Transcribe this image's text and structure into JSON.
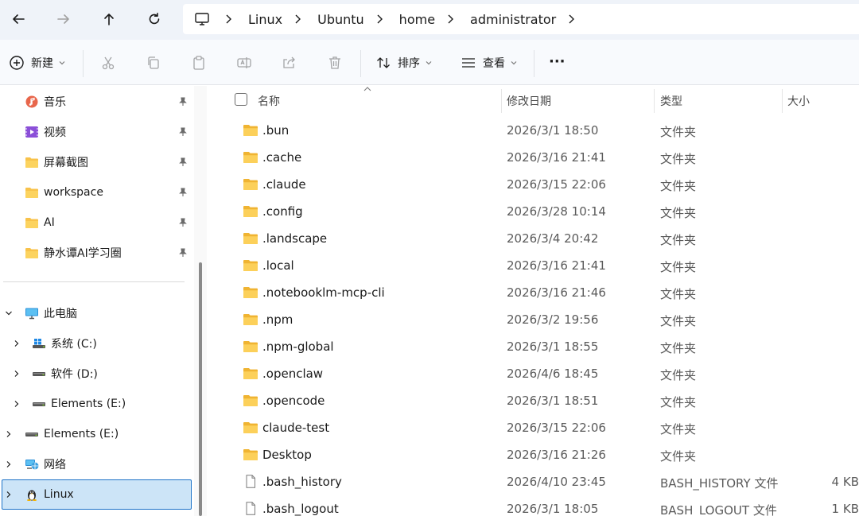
{
  "navigation": {
    "back": "back-arrow",
    "forward": "forward-arrow",
    "up": "up-arrow",
    "refresh": "refresh"
  },
  "address": {
    "root_icon": "this-pc-icon",
    "crumbs": [
      "Linux",
      "Ubuntu",
      "home",
      "administrator"
    ]
  },
  "toolbar": {
    "new_label": "新建",
    "sort_label": "排序",
    "view_label": "查看",
    "more_label": "···"
  },
  "sidebar": {
    "quick_access": [
      {
        "label": "音乐",
        "icon": "music-icon"
      },
      {
        "label": "视频",
        "icon": "video-icon"
      },
      {
        "label": "屏幕截图",
        "icon": "folder-icon"
      },
      {
        "label": "workspace",
        "icon": "folder-icon"
      },
      {
        "label": "AI",
        "icon": "folder-icon"
      },
      {
        "label": "静水谭AI学习圈",
        "icon": "folder-icon"
      }
    ],
    "this_pc": "此电脑",
    "drives": [
      {
        "label": "系统 (C:)",
        "icon": "windows-drive-icon"
      },
      {
        "label": "软件 (D:)",
        "icon": "drive-icon"
      },
      {
        "label": "Elements (E:)",
        "icon": "drive-icon"
      }
    ],
    "elements": "Elements (E:)",
    "network": "网络",
    "linux": "Linux"
  },
  "columns": {
    "name": "名称",
    "date": "修改日期",
    "type": "类型",
    "size": "大小"
  },
  "files": [
    {
      "name": ".bun",
      "date": "2026/3/1 18:50",
      "type": "文件夹",
      "size": "",
      "kind": "folder"
    },
    {
      "name": ".cache",
      "date": "2026/3/16 21:41",
      "type": "文件夹",
      "size": "",
      "kind": "folder"
    },
    {
      "name": ".claude",
      "date": "2026/3/15 22:06",
      "type": "文件夹",
      "size": "",
      "kind": "folder"
    },
    {
      "name": ".config",
      "date": "2026/3/28 10:14",
      "type": "文件夹",
      "size": "",
      "kind": "folder"
    },
    {
      "name": ".landscape",
      "date": "2026/3/4 20:42",
      "type": "文件夹",
      "size": "",
      "kind": "folder"
    },
    {
      "name": ".local",
      "date": "2026/3/16 21:41",
      "type": "文件夹",
      "size": "",
      "kind": "folder"
    },
    {
      "name": ".notebooklm-mcp-cli",
      "date": "2026/3/16 21:46",
      "type": "文件夹",
      "size": "",
      "kind": "folder"
    },
    {
      "name": ".npm",
      "date": "2026/3/2 19:56",
      "type": "文件夹",
      "size": "",
      "kind": "folder"
    },
    {
      "name": ".npm-global",
      "date": "2026/3/1 18:55",
      "type": "文件夹",
      "size": "",
      "kind": "folder"
    },
    {
      "name": ".openclaw",
      "date": "2026/4/6 18:45",
      "type": "文件夹",
      "size": "",
      "kind": "folder"
    },
    {
      "name": ".opencode",
      "date": "2026/3/1 18:51",
      "type": "文件夹",
      "size": "",
      "kind": "folder"
    },
    {
      "name": "claude-test",
      "date": "2026/3/15 22:06",
      "type": "文件夹",
      "size": "",
      "kind": "folder"
    },
    {
      "name": "Desktop",
      "date": "2026/3/16 21:26",
      "type": "文件夹",
      "size": "",
      "kind": "folder"
    },
    {
      "name": ".bash_history",
      "date": "2026/4/10 23:45",
      "type": "BASH_HISTORY 文件",
      "size": "4 KB",
      "kind": "file"
    },
    {
      "name": ".bash_logout",
      "date": "2026/3/1 18:05",
      "type": "BASH_LOGOUT 文件",
      "size": "1 KB",
      "kind": "file"
    }
  ],
  "colors": {
    "folder": "#f8c24a",
    "selection": "#cce4f7",
    "selection_border": "#1e73c8",
    "nav_bg": "#eff3f9"
  }
}
